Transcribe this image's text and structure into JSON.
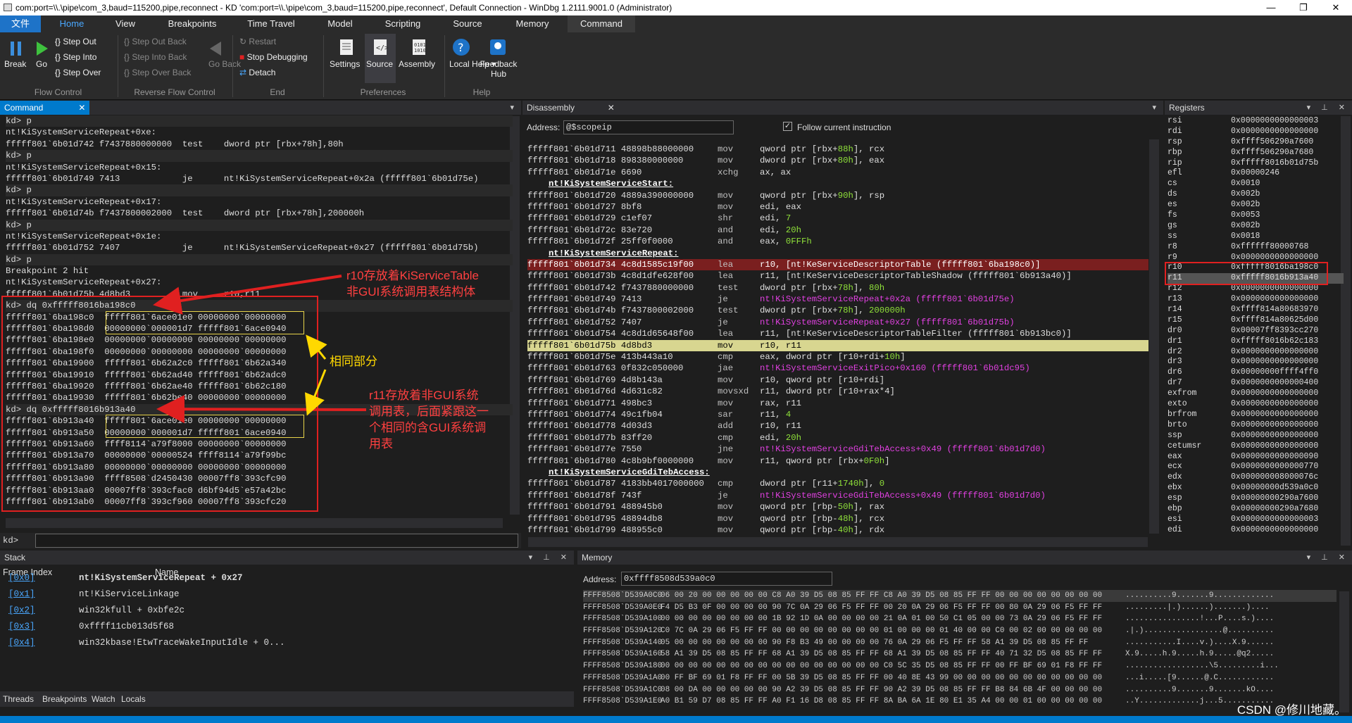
{
  "window": {
    "title": "com:port=\\\\.\\pipe\\com_3,baud=115200,pipe,reconnect - KD 'com:port=\\\\.\\pipe\\com_3,baud=115200,pipe,reconnect', Default Connection  - WinDbg 1.2111.9001.0 (Administrator)",
    "min": "—",
    "max": "❐",
    "close": "✕"
  },
  "tabs": [
    "文件",
    "Home",
    "View",
    "Breakpoints",
    "Time Travel",
    "Model",
    "Scripting",
    "Source",
    "Memory",
    "Command"
  ],
  "ribbon": {
    "flow": {
      "break": "Break",
      "go": "Go",
      "step_out": "Step Out",
      "step_into": "Step Into",
      "step_over": "Step Over",
      "group": "Flow Control"
    },
    "reverse": {
      "step_out_back": "Step Out Back",
      "step_into_back": "Step Into Back",
      "step_over_back": "Step Over Back",
      "go_back": "Go Back",
      "group": "Reverse Flow Control"
    },
    "end": {
      "restart": "Restart",
      "stop": "Stop Debugging",
      "detach": "Detach",
      "group": "End"
    },
    "prefs": {
      "settings": "Settings",
      "source": "Source",
      "assembly": "Assembly",
      "group": "Preferences"
    },
    "help": {
      "local_help": "Local Help",
      "feedback": "Feedback Hub",
      "group": "Help"
    }
  },
  "command_panel": {
    "title": "Command",
    "prompt": "kd>",
    "lines": [
      "kd> p",
      "nt!KiSystemServiceRepeat+0xe:",
      "fffff801`6b01d742 f7437880000000  test    dword ptr [rbx+78h],80h",
      "kd> p",
      "nt!KiSystemServiceRepeat+0x15:",
      "fffff801`6b01d749 7413            je      nt!KiSystemServiceRepeat+0x2a (fffff801`6b01d75e)",
      "kd> p",
      "nt!KiSystemServiceRepeat+0x17:",
      "fffff801`6b01d74b f7437800002000  test    dword ptr [rbx+78h],200000h",
      "kd> p",
      "nt!KiSystemServiceRepeat+0x1e:",
      "fffff801`6b01d752 7407            je      nt!KiSystemServiceRepeat+0x27 (fffff801`6b01d75b)",
      "kd> p",
      "Breakpoint 2 hit",
      "nt!KiSystemServiceRepeat+0x27:",
      "fffff801`6b01d75b 4d8bd3          mov     r10,r11",
      "kd> dq 0xfffff8016ba198c0",
      "fffff801`6ba198c0  fffff801`6ace01e0 00000000`00000000",
      "fffff801`6ba198d0  00000000`000001d7 fffff801`6ace0940",
      "fffff801`6ba198e0  00000000`00000000 00000000`00000000",
      "fffff801`6ba198f0  00000000`00000000 00000000`00000000",
      "fffff801`6ba19900  fffff801`6b62a2c0 fffff801`6b62a340",
      "fffff801`6ba19910  fffff801`6b62ad40 fffff801`6b62adc0",
      "fffff801`6ba19920  fffff801`6b62ae40 fffff801`6b62c180",
      "fffff801`6ba19930  fffff801`6b62be40 00000000`00000000",
      "kd> dq 0xfffff8016b913a40",
      "fffff801`6b913a40  fffff801`6ace01e0 00000000`00000000",
      "fffff801`6b913a50  00000000`000001d7 fffff801`6ace0940",
      "fffff801`6b913a60  ffff8114`a79f8000 00000000`00000000",
      "fffff801`6b913a70  00000000`00000524 ffff8114`a79f99bc",
      "fffff801`6b913a80  00000000`00000000 00000000`00000000",
      "fffff801`6b913a90  ffff8508`d2450430 00007ff8`393cfc90",
      "fffff801`6b913aa0  00007ff8`393cfac0 d6bf94d5`e57a42bc",
      "fffff801`6b913ab0  00007ff8`393cf960 00007ff8`393cfc20"
    ]
  },
  "annotations": {
    "r10": [
      "r10存放着KiServiceTable",
      "非GUI系统调用表结构体"
    ],
    "same": "相同部分",
    "r11": [
      "r11存放着非GUI系统",
      "调用表，后面紧跟这一",
      "个相同的含GUI系统调",
      "用表"
    ]
  },
  "disassembly": {
    "title": "Disassembly",
    "address_label": "Address:",
    "address": "@$scopeip",
    "follow_label": "Follow current instruction",
    "lines": [
      {
        "t": "i",
        "a": "fffff801`6b01d711 48898b88000000",
        "o": "mov",
        "s": "qword ptr [rbx+88h], rcx"
      },
      {
        "t": "i",
        "a": "fffff801`6b01d718 898380000000",
        "o": "mov",
        "s": "dword ptr [rbx+80h], eax"
      },
      {
        "t": "i",
        "a": "fffff801`6b01d71e 6690",
        "o": "xchg",
        "s": "ax, ax"
      },
      {
        "t": "l",
        "a": "nt!KiSystemServiceStart:"
      },
      {
        "t": "i",
        "a": "fffff801`6b01d720 4889a390000000",
        "o": "mov",
        "s": "qword ptr [rbx+90h], rsp"
      },
      {
        "t": "i",
        "a": "fffff801`6b01d727 8bf8",
        "o": "mov",
        "s": "edi, eax"
      },
      {
        "t": "i",
        "a": "fffff801`6b01d729 c1ef07",
        "o": "shr",
        "s": "edi, 7"
      },
      {
        "t": "i",
        "a": "fffff801`6b01d72c 83e720",
        "o": "and",
        "s": "edi, 20h"
      },
      {
        "t": "i",
        "a": "fffff801`6b01d72f 25ff0f0000",
        "o": "and",
        "s": "eax, 0FFFh"
      },
      {
        "t": "l",
        "a": "nt!KiSystemServiceRepeat:"
      },
      {
        "t": "bp",
        "a": "fffff801`6b01d734 4c8d1585c19f00",
        "o": "lea",
        "s": "r10, [nt!KeServiceDescriptorTable (fffff801`6ba198c0)]"
      },
      {
        "t": "i",
        "a": "fffff801`6b01d73b 4c8d1dfe628f00",
        "o": "lea",
        "s": "r11, [nt!KeServiceDescriptorTableShadow (fffff801`6b913a40)]"
      },
      {
        "t": "i",
        "a": "fffff801`6b01d742 f7437880000000",
        "o": "test",
        "s": "dword ptr [rbx+78h], 80h"
      },
      {
        "t": "j",
        "a": "fffff801`6b01d749 7413",
        "o": "je",
        "s": "nt!KiSystemServiceRepeat+0x2a (fffff801`6b01d75e)"
      },
      {
        "t": "i",
        "a": "fffff801`6b01d74b f7437800002000",
        "o": "test",
        "s": "dword ptr [rbx+78h], 200000h"
      },
      {
        "t": "j",
        "a": "fffff801`6b01d752 7407",
        "o": "je",
        "s": "nt!KiSystemServiceRepeat+0x27 (fffff801`6b01d75b)"
      },
      {
        "t": "i",
        "a": "fffff801`6b01d754 4c8d1d65648f00",
        "o": "lea",
        "s": "r11, [nt!KeServiceDescriptorTableFilter (fffff801`6b913bc0)]"
      },
      {
        "t": "cur",
        "a": "fffff801`6b01d75b 4d8bd3",
        "o": "mov",
        "s": "r10, r11"
      },
      {
        "t": "i",
        "a": "fffff801`6b01d75e 413b443a10",
        "o": "cmp",
        "s": "eax, dword ptr [r10+rdi+10h]"
      },
      {
        "t": "j",
        "a": "fffff801`6b01d763 0f832c050000",
        "o": "jae",
        "s": "nt!KiSystemServiceExitPico+0x160 (fffff801`6b01dc95)"
      },
      {
        "t": "i",
        "a": "fffff801`6b01d769 4d8b143a",
        "o": "mov",
        "s": "r10, qword ptr [r10+rdi]"
      },
      {
        "t": "i",
        "a": "fffff801`6b01d76d 4d631c82",
        "o": "movsxd",
        "s": "r11, dword ptr [r10+rax*4]"
      },
      {
        "t": "i",
        "a": "fffff801`6b01d771 498bc3",
        "o": "mov",
        "s": "rax, r11"
      },
      {
        "t": "i",
        "a": "fffff801`6b01d774 49c1fb04",
        "o": "sar",
        "s": "r11, 4"
      },
      {
        "t": "i",
        "a": "fffff801`6b01d778 4d03d3",
        "o": "add",
        "s": "r10, r11"
      },
      {
        "t": "i",
        "a": "fffff801`6b01d77b 83ff20",
        "o": "cmp",
        "s": "edi, 20h"
      },
      {
        "t": "j",
        "a": "fffff801`6b01d77e 7550",
        "o": "jne",
        "s": "nt!KiSystemServiceGdiTebAccess+0x49 (fffff801`6b01d7d0)"
      },
      {
        "t": "i",
        "a": "fffff801`6b01d780 4c8b9bf0000000",
        "o": "mov",
        "s": "r11, qword ptr [rbx+0F0h]"
      },
      {
        "t": "l",
        "a": "nt!KiSystemServiceGdiTebAccess:"
      },
      {
        "t": "i",
        "a": "fffff801`6b01d787 4183bb4017000000",
        "o": "cmp",
        "s": "dword ptr [r11+1740h], 0"
      },
      {
        "t": "j",
        "a": "fffff801`6b01d78f 743f",
        "o": "je",
        "s": "nt!KiSystemServiceGdiTebAccess+0x49 (fffff801`6b01d7d0)"
      },
      {
        "t": "i",
        "a": "fffff801`6b01d791 488945b0",
        "o": "mov",
        "s": "qword ptr [rbp-50h], rax"
      },
      {
        "t": "i",
        "a": "fffff801`6b01d795 48894db8",
        "o": "mov",
        "s": "qword ptr [rbp-48h], rcx"
      },
      {
        "t": "i",
        "a": "fffff801`6b01d799 488955c0",
        "o": "mov",
        "s": "qword ptr [rbp-40h], rdx"
      }
    ]
  },
  "registers": {
    "title": "Registers",
    "rows": [
      [
        "rsi",
        "0x0000000000000003"
      ],
      [
        "rdi",
        "0x0000000000000000"
      ],
      [
        "rsp",
        "0xffff506290a7600"
      ],
      [
        "rbp",
        "0xffff506290a7680"
      ],
      [
        "rip",
        "0xfffff8016b01d75b"
      ],
      [
        "efl",
        "0x00000246"
      ],
      [
        "cs",
        "0x0010"
      ],
      [
        "ds",
        "0x002b"
      ],
      [
        "es",
        "0x002b"
      ],
      [
        "fs",
        "0x0053"
      ],
      [
        "gs",
        "0x002b"
      ],
      [
        "ss",
        "0x0018"
      ],
      [
        "r8",
        "0xffffff80000768"
      ],
      [
        "r9",
        "0x0000000000000000"
      ],
      [
        "r10",
        "0xfffff8016ba198c0"
      ],
      [
        "r11",
        "0xfffff8016b913a40"
      ],
      [
        "r12",
        "0x0000000000000000"
      ],
      [
        "r13",
        "0x0000000000000000"
      ],
      [
        "r14",
        "0xffff814a80683970"
      ],
      [
        "r15",
        "0xffff814a80625d00"
      ],
      [
        "dr0",
        "0x00007ff8393cc270"
      ],
      [
        "dr1",
        "0xfffff8016b62c183"
      ],
      [
        "dr2",
        "0x0000000000000000"
      ],
      [
        "dr3",
        "0x0000000000000000"
      ],
      [
        "dr6",
        "0x00000000ffff4ff0"
      ],
      [
        "dr7",
        "0x0000000000000400"
      ],
      [
        "exfrom",
        "0x0000000000000000"
      ],
      [
        "exto",
        "0x0000000000000000"
      ],
      [
        "brfrom",
        "0x0000000000000000"
      ],
      [
        "brto",
        "0x0000000000000000"
      ],
      [
        "ssp",
        "0x0000000000000000"
      ],
      [
        "cetumsr",
        "0x0000000000000000"
      ],
      [
        "eax",
        "0x0000000000000090"
      ],
      [
        "ecx",
        "0x0000000000000770"
      ],
      [
        "edx",
        "0x000000008000076c"
      ],
      [
        "ebx",
        "0x00000000d539a0c0"
      ],
      [
        "esp",
        "0x00000000290a7600"
      ],
      [
        "ebp",
        "0x00000000290a7680"
      ],
      [
        "esi",
        "0x0000000000000003"
      ],
      [
        "edi",
        "0x0000000000000000"
      ]
    ]
  },
  "stack": {
    "title": "Stack",
    "col_index": "Frame Index",
    "col_name": "Name",
    "rows": [
      [
        "[0x0]",
        "nt!KiSystemServiceRepeat + 0x27"
      ],
      [
        "[0x1]",
        "nt!KiServiceLinkage"
      ],
      [
        "[0x2]",
        "win32kfull + 0xbfe2c"
      ],
      [
        "[0x3]",
        "0xffff11cb013d5f68"
      ],
      [
        "[0x4]",
        "win32kbase!EtwTraceWakeInputIdle + 0..."
      ]
    ]
  },
  "memory": {
    "title": "Memory",
    "address_label": "Address:",
    "address": "0xffff8508d539a0c0",
    "lines": [
      [
        "FFFF8508`D539A0C0",
        "06 00 20 00 00 00 00 00 C8 A0 39 D5 08 85 FF FF C8 A0 39 D5 08 85 FF FF 00 00 00 00 00 00 00 00",
        "..........9.......9............."
      ],
      [
        "FFFF8508`D539A0E0",
        "F4 D5 B3 0F 00 00 00 00 90 7C 0A 29 06 F5 FF FF 00 20 0A 29 06 F5 FF FF 00 80 0A 29 06 F5 FF FF",
        ".........|.)......).......)...."
      ],
      [
        "FFFF8508`D539A100",
        "00 00 00 00 00 00 00 00 1B 92 1D 0A 00 00 00 00 21 0A 01 00 50 C1 05 00 00 73 0A 29 06 F5 FF FF",
        "................!...P....s.)...."
      ],
      [
        "FFFF8508`D539A120",
        "C0 7C 0A 29 06 F5 FF FF 00 00 00 00 00 00 00 00 01 00 00 00 01 40 00 00 C0 00 02 00 00 00 00 00",
        ".|.).................@.........."
      ],
      [
        "FFFF8508`D539A140",
        "05 00 00 00 00 00 00 00 90 F8 B3 49 00 00 00 00 76 0A 29 06 F5 FF FF 58 A1 39 D5 08 85 FF FF",
        "...........I....v.)....X.9......"
      ],
      [
        "FFFF8508`D539A160",
        "58 A1 39 D5 08 85 FF FF 68 A1 39 D5 08 85 FF FF 68 A1 39 D5 08 85 FF FF 40 71 32 D5 08 85 FF FF",
        "X.9.....h.9.....h.9.....@q2....."
      ],
      [
        "FFFF8508`D539A180",
        "00 00 00 00 00 00 00 00 00 00 00 00 00 00 00 00 C0 5C 35 D5 08 85 FF FF 00 FF BF 69 01 F8 FF FF",
        "..................\\5.........i..."
      ],
      [
        "FFFF8508`D539A1A0",
        "00 FF BF 69 01 F8 FF FF 00 5B 39 D5 08 85 FF FF 00 40 8E 43 99 00 00 00 00 00 00 00 00 00 00 00",
        "...i.....[9......@.C............"
      ],
      [
        "FFFF8508`D539A1C0",
        "08 00 DA 00 00 00 00 00 90 A2 39 D5 08 85 FF FF 90 A2 39 D5 08 85 FF FF B8 84 6B 4F 00 00 00 00",
        "..........9.......9.......kO...."
      ],
      [
        "FFFF8508`D539A1E0",
        "A0 B1 59 D7 08 85 FF FF A0 F1 16 D8 08 85 FF FF 8A BA 6A 1E 80 E1 35 A4 00 00 01 00 00 00 00 00",
        "..Y.............j...5..........."
      ]
    ]
  },
  "bottom": {
    "threads": "Threads",
    "breakpoints": "Breakpoints",
    "watch": "Watch",
    "locals": "Locals"
  },
  "watermark": "CSDN @修川地藏。",
  "colors": {
    "accent": "#007acc",
    "breakpoint": "#7a1f1f",
    "current": "#d8d690",
    "jump": "#e040e0",
    "number": "#8fe03a"
  }
}
